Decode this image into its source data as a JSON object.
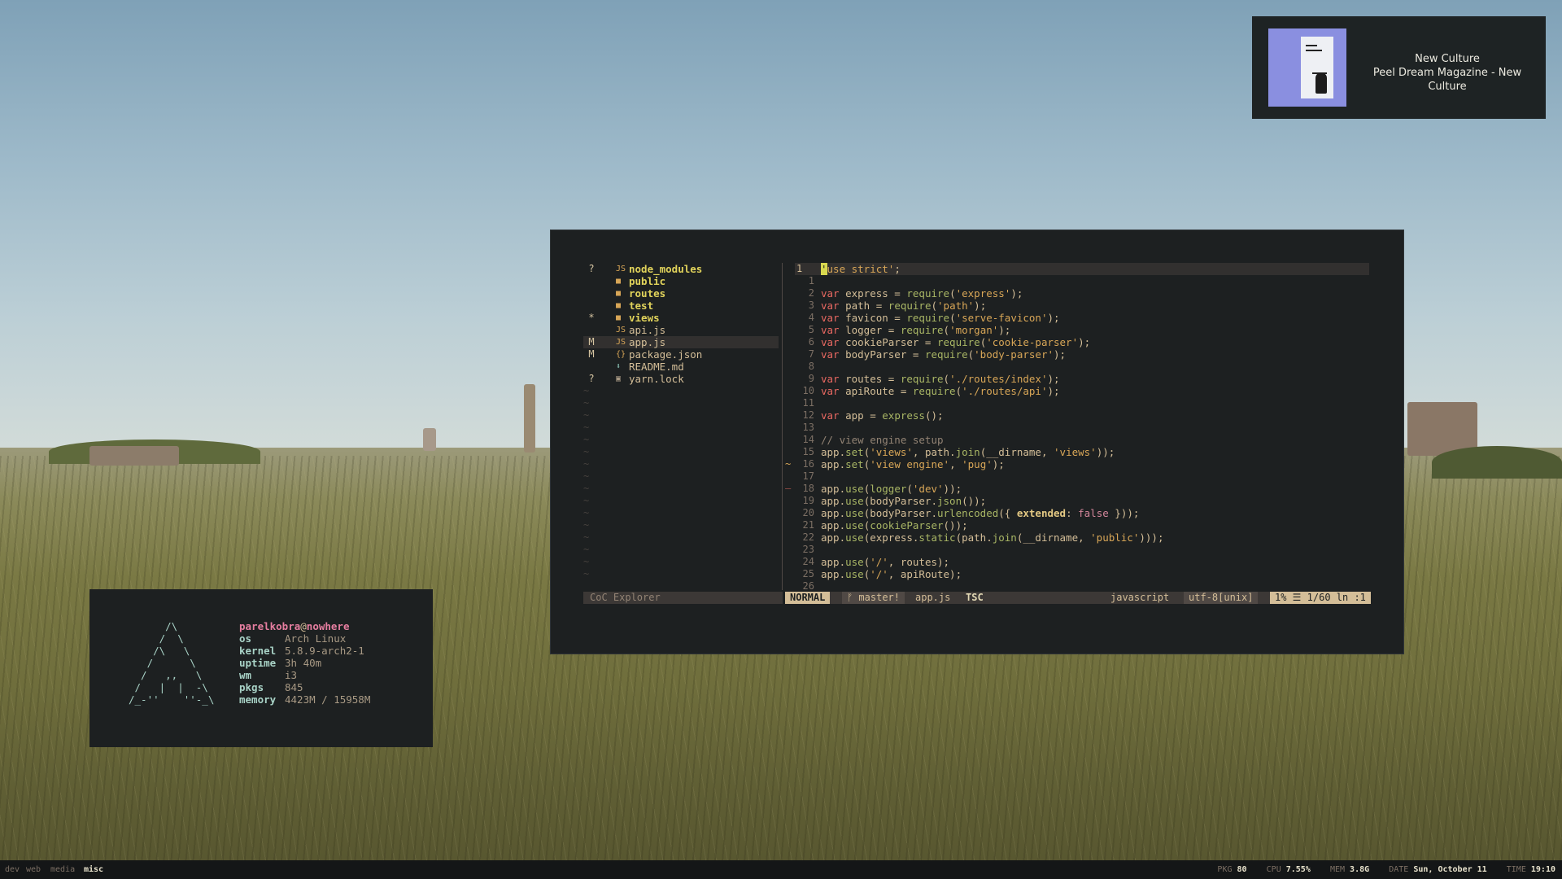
{
  "notification": {
    "line1": "New Culture",
    "line2": "Peel Dream Magazine - New Culture"
  },
  "explorer": {
    "status": "CoC Explorer",
    "items": [
      {
        "git": "?",
        "icon": "JS",
        "name": "node_modules",
        "dir": true
      },
      {
        "git": "",
        "icon": "folder",
        "name": "public",
        "dir": true
      },
      {
        "git": "",
        "icon": "folder",
        "name": "routes",
        "dir": true
      },
      {
        "git": "",
        "icon": "folder",
        "name": "test",
        "dir": true
      },
      {
        "git": "*",
        "icon": "folder",
        "name": "views",
        "dir": true
      },
      {
        "git": "",
        "icon": "JS",
        "name": "api.js",
        "dir": false
      },
      {
        "git": "M",
        "icon": "JS",
        "name": "app.js",
        "dir": false
      },
      {
        "git": "M",
        "icon": "{}",
        "name": "package.json",
        "dir": false
      },
      {
        "git": "",
        "icon": "markdown",
        "name": "README.md",
        "dir": false
      },
      {
        "git": "?",
        "icon": "lock",
        "name": "yarn.lock",
        "dir": false
      }
    ]
  },
  "editor": {
    "lines": [
      {
        "n": "1",
        "text": "'use strict';"
      },
      {
        "n": "1",
        "text": ""
      },
      {
        "n": "2",
        "text": "var express = require('express');"
      },
      {
        "n": "3",
        "text": "var path = require('path');"
      },
      {
        "n": "4",
        "text": "var favicon = require('serve-favicon');"
      },
      {
        "n": "5",
        "text": "var logger = require('morgan');"
      },
      {
        "n": "6",
        "text": "var cookieParser = require('cookie-parser');"
      },
      {
        "n": "7",
        "text": "var bodyParser = require('body-parser');"
      },
      {
        "n": "8",
        "text": ""
      },
      {
        "n": "9",
        "text": "var routes = require('./routes/index');"
      },
      {
        "n": "10",
        "text": "var apiRoute = require('./routes/api');"
      },
      {
        "n": "11",
        "text": ""
      },
      {
        "n": "12",
        "text": "var app = express();"
      },
      {
        "n": "13",
        "text": ""
      },
      {
        "n": "14",
        "text": "// view engine setup"
      },
      {
        "n": "15",
        "text": "app.set('views', path.join(__dirname, 'views'));"
      },
      {
        "n": "16",
        "text": "app.set('view engine', 'pug');"
      },
      {
        "n": "17",
        "text": ""
      },
      {
        "n": "18",
        "text": "app.use(logger('dev'));"
      },
      {
        "n": "19",
        "text": "app.use(bodyParser.json());"
      },
      {
        "n": "20",
        "text": "app.use(bodyParser.urlencoded({ extended: false }));"
      },
      {
        "n": "21",
        "text": "app.use(cookieParser());"
      },
      {
        "n": "22",
        "text": "app.use(express.static(path.join(__dirname, 'public')));"
      },
      {
        "n": "23",
        "text": ""
      },
      {
        "n": "24",
        "text": "app.use('/', routes);"
      },
      {
        "n": "25",
        "text": "app.use('/', apiRoute);"
      },
      {
        "n": "26",
        "text": ""
      }
    ]
  },
  "statusline": {
    "mode": "NORMAL",
    "branch": "ᚠ master!",
    "file": "app.js",
    "lsp": "TSC",
    "filetype": "javascript",
    "encoding": "utf-8[unix]",
    "position": "1% ☰ 1/60 ln :1"
  },
  "fetch": {
    "user": "parelkobra",
    "at": "@",
    "host": "nowhere",
    "rows": [
      {
        "key": "os",
        "value": "Arch Linux"
      },
      {
        "key": "kernel",
        "value": "5.8.9-arch2-1"
      },
      {
        "key": "uptime",
        "value": "3h 40m"
      },
      {
        "key": "wm",
        "value": "i3"
      },
      {
        "key": "pkgs",
        "value": "845"
      },
      {
        "key": "memory",
        "value": "4423M / 15958M"
      }
    ],
    "art": "      /\\\n     /  \\\n    /\\   \\\n   /      \\\n  /   ,,   \\\n /   |  |  -\\\n/_-''    ''-_\\"
  },
  "bar": {
    "workspaces": [
      "dev",
      "web",
      "media",
      "misc"
    ],
    "active_workspace": "misc",
    "pkg_label": "PKG",
    "pkg": "80",
    "cpu_label": "CPU",
    "cpu": "7.55%",
    "mem_label": "MEM",
    "mem": "3.8G",
    "date_label": "DATE",
    "date": "Sun, October 11",
    "time_label": "TIME",
    "time": "19:10"
  }
}
